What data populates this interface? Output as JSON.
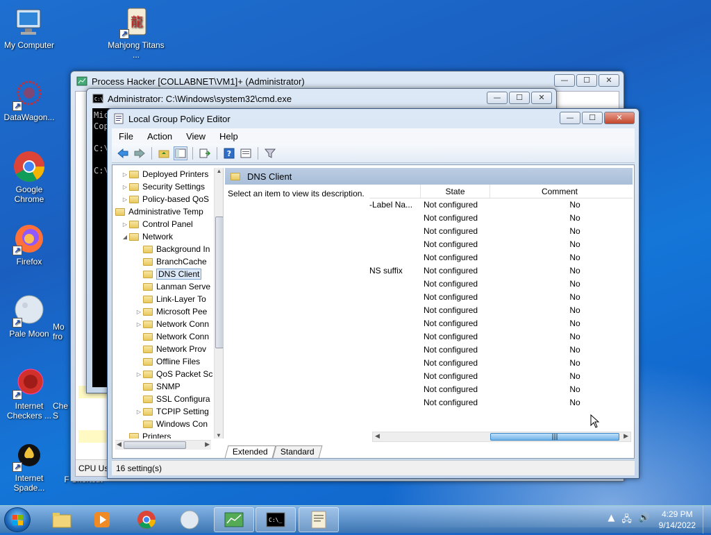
{
  "desktop": {
    "icons": [
      {
        "label": "My Computer"
      },
      {
        "label": "Mahjong Titans ..."
      },
      {
        "label": "DataWagon..."
      },
      {
        "label": "Google Chrome"
      },
      {
        "label": "Firefox"
      },
      {
        "label": "Pale Moon"
      },
      {
        "label": "Internet Checkers ..."
      },
      {
        "label": "Internet Spade..."
      }
    ],
    "partial_icon_labels": [
      "Mo fro",
      "Che S",
      "F Shortcut"
    ]
  },
  "process_hacker": {
    "title": "Process Hacker [COLLABNET\\VM1]+ (Administrator)",
    "status_fragment": "CPU Usa"
  },
  "cmd": {
    "title": "Administrator: C:\\Windows\\system32\\cmd.exe",
    "lines": [
      "Mic",
      "Cop",
      "C:\\",
      "C:\\"
    ]
  },
  "gpedit": {
    "title": "Local Group Policy Editor",
    "menu": [
      "File",
      "Action",
      "View",
      "Help"
    ],
    "tree": [
      {
        "label": "Deployed Printers",
        "indent": 0,
        "expander": "▷"
      },
      {
        "label": "Security Settings",
        "indent": 0,
        "expander": "▷"
      },
      {
        "label": "Policy-based QoS",
        "indent": 0,
        "expander": "▷"
      },
      {
        "label": "Administrative Temp",
        "indent": -1,
        "expander": "◢"
      },
      {
        "label": "Control Panel",
        "indent": 0,
        "expander": "▷"
      },
      {
        "label": "Network",
        "indent": 0,
        "expander": "◢"
      },
      {
        "label": "Background In",
        "indent": 1,
        "expander": ""
      },
      {
        "label": "BranchCache",
        "indent": 1,
        "expander": ""
      },
      {
        "label": "DNS Client",
        "indent": 1,
        "expander": "",
        "selected": true
      },
      {
        "label": "Lanman Serve",
        "indent": 1,
        "expander": ""
      },
      {
        "label": "Link-Layer To",
        "indent": 1,
        "expander": ""
      },
      {
        "label": "Microsoft Pee",
        "indent": 1,
        "expander": "▷"
      },
      {
        "label": "Network Conn",
        "indent": 1,
        "expander": "▷"
      },
      {
        "label": "Network Conn",
        "indent": 1,
        "expander": ""
      },
      {
        "label": "Network Prov",
        "indent": 1,
        "expander": ""
      },
      {
        "label": "Offline Files",
        "indent": 1,
        "expander": ""
      },
      {
        "label": "QoS Packet Sc",
        "indent": 1,
        "expander": "▷"
      },
      {
        "label": "SNMP",
        "indent": 1,
        "expander": ""
      },
      {
        "label": "SSL Configura",
        "indent": 1,
        "expander": ""
      },
      {
        "label": "TCPIP Setting",
        "indent": 1,
        "expander": "▷"
      },
      {
        "label": "Windows Con",
        "indent": 1,
        "expander": ""
      },
      {
        "label": "Printers",
        "indent": 0,
        "expander": ""
      }
    ],
    "detail_title": "DNS Client",
    "description": "Select an item to view its description.",
    "columns": {
      "state": "State",
      "comment": "Comment"
    },
    "rows": [
      {
        "setting": "-Label Na...",
        "state": "Not configured",
        "comment": "No"
      },
      {
        "setting": "",
        "state": "Not configured",
        "comment": "No"
      },
      {
        "setting": "",
        "state": "Not configured",
        "comment": "No"
      },
      {
        "setting": "",
        "state": "Not configured",
        "comment": "No"
      },
      {
        "setting": "",
        "state": "Not configured",
        "comment": "No"
      },
      {
        "setting": "NS suffix",
        "state": "Not configured",
        "comment": "No"
      },
      {
        "setting": "",
        "state": "Not configured",
        "comment": "No"
      },
      {
        "setting": "",
        "state": "Not configured",
        "comment": "No"
      },
      {
        "setting": "",
        "state": "Not configured",
        "comment": "No"
      },
      {
        "setting": "",
        "state": "Not configured",
        "comment": "No"
      },
      {
        "setting": "",
        "state": "Not configured",
        "comment": "No"
      },
      {
        "setting": "",
        "state": "Not configured",
        "comment": "No"
      },
      {
        "setting": "",
        "state": "Not configured",
        "comment": "No"
      },
      {
        "setting": "",
        "state": "Not configured",
        "comment": "No"
      },
      {
        "setting": "",
        "state": "Not configured",
        "comment": "No"
      },
      {
        "setting": "",
        "state": "Not configured",
        "comment": "No"
      }
    ],
    "tabs": [
      "Extended",
      "Standard"
    ],
    "status": "16 setting(s)"
  },
  "taskbar": {
    "time": "4:29 PM",
    "date": "9/14/2022"
  }
}
